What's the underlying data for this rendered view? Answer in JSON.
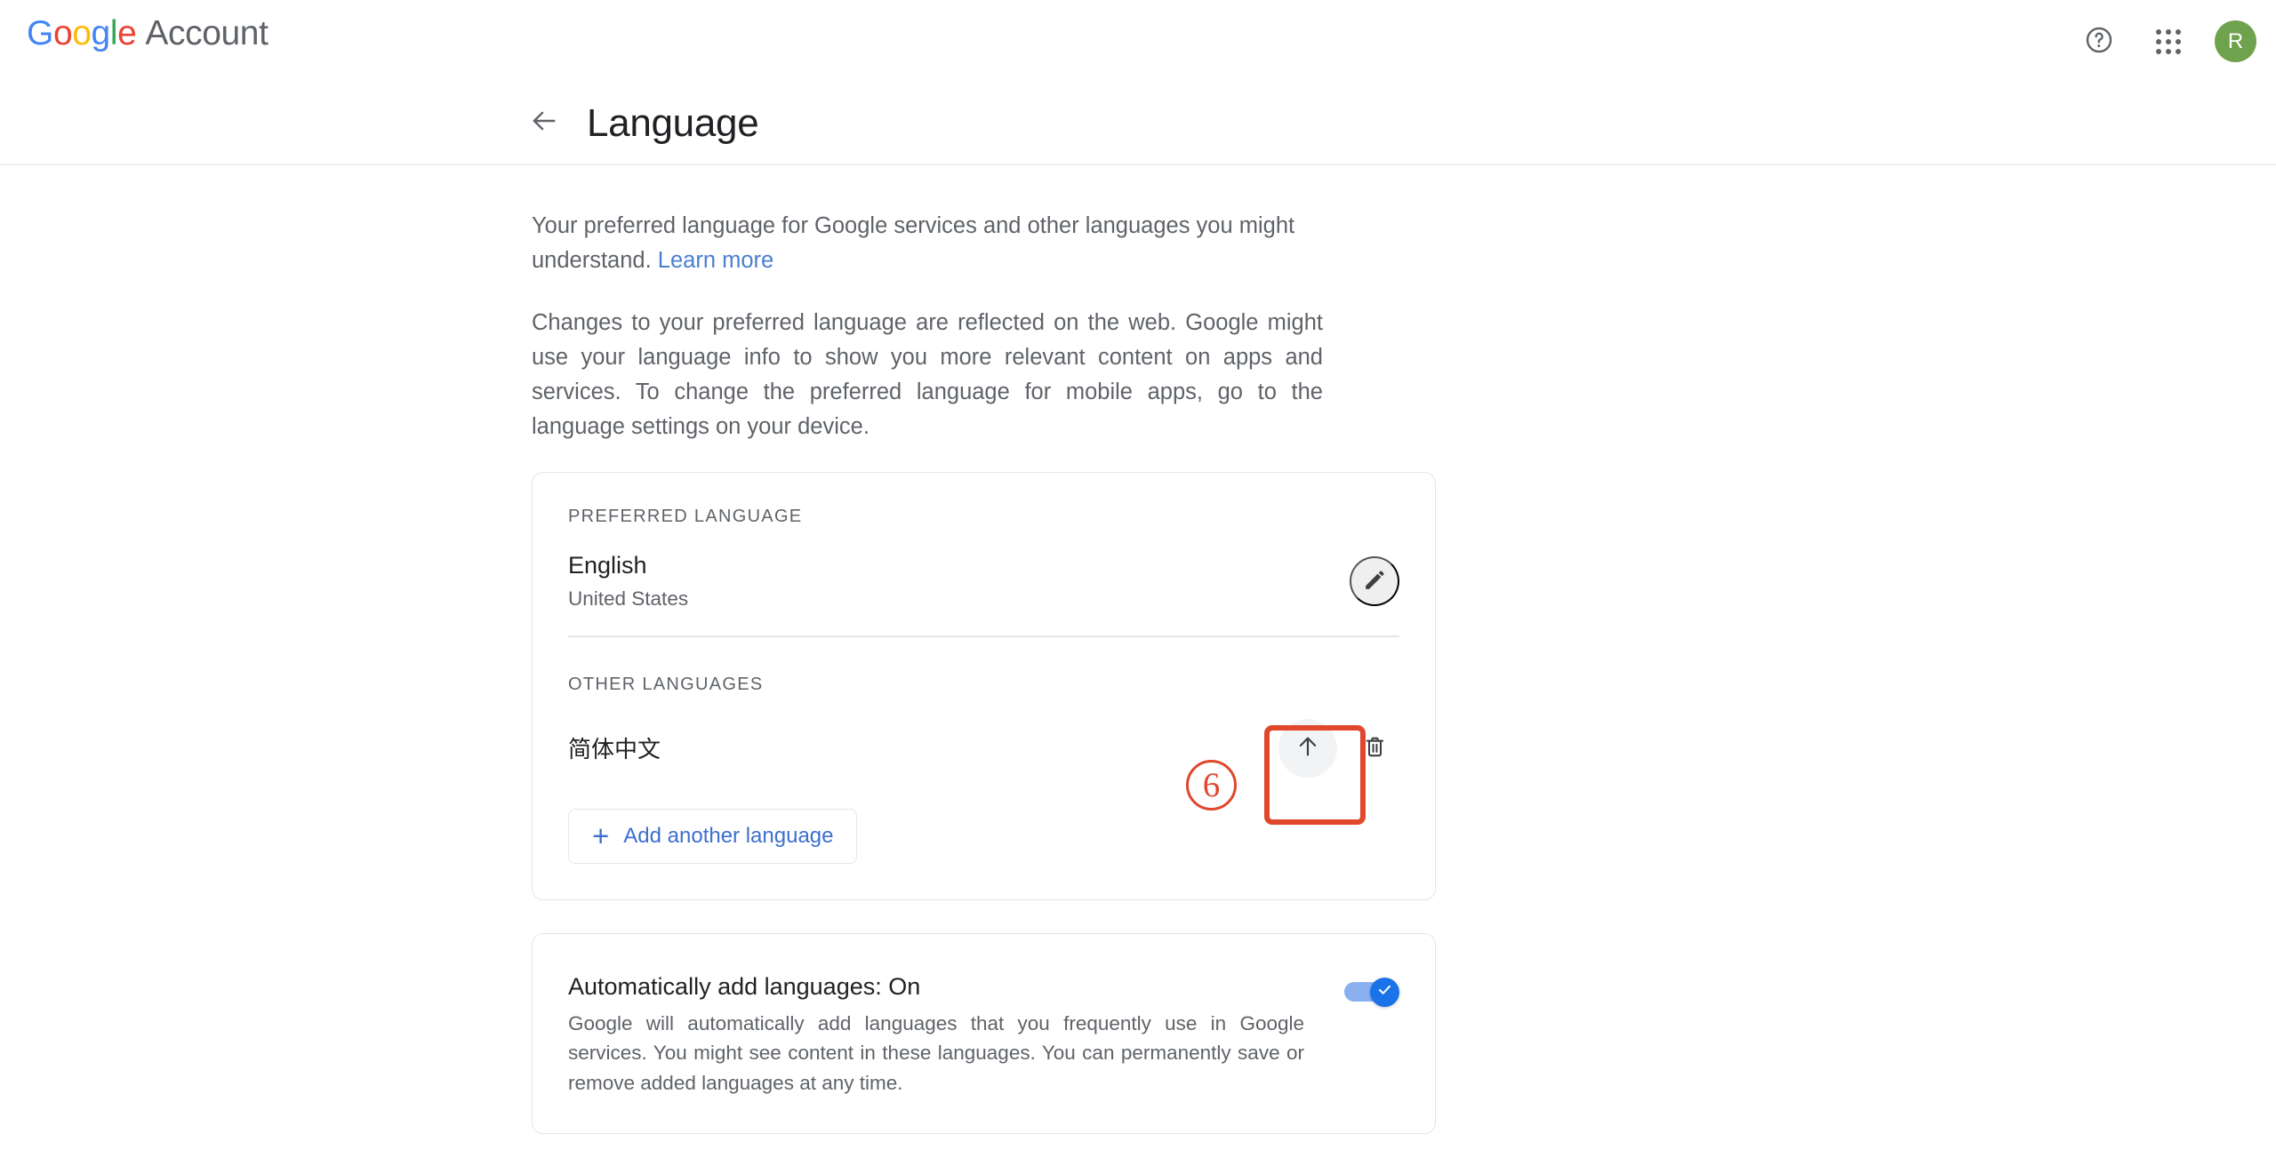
{
  "header": {
    "brand_google": "Google",
    "brand_google_letters": [
      "G",
      "o",
      "o",
      "g",
      "l",
      "e"
    ],
    "brand_account": "Account",
    "help_icon": "help-circle-icon",
    "apps_icon": "apps-grid-icon",
    "avatar_initial": "R",
    "avatar_color": "#6fa24c"
  },
  "title_bar": {
    "back_icon": "arrow-left-icon",
    "title": "Language"
  },
  "intro": {
    "paragraph_1_before_link": "Your preferred language for Google services and other languages you might understand. ",
    "learn_more": "Learn more",
    "paragraph_2": "Changes to your preferred language are reflected on the web. Google might use your language info to show you more relevant content on apps and services. To change the preferred language for mobile apps, go to the language settings on your device."
  },
  "language_card": {
    "preferred_label": "PREFERRED LANGUAGE",
    "preferred_language": "English",
    "preferred_region": "United States",
    "edit_icon": "pencil-icon",
    "other_label": "OTHER LANGUAGES",
    "other_language": "简体中文",
    "move_up_icon": "arrow-up-icon",
    "delete_icon": "trash-icon",
    "add_button_label": "Add another language",
    "add_button_plus": "+"
  },
  "annotation": {
    "step_number": "6",
    "color": "#e0472c"
  },
  "auto_card": {
    "title": "Automatically add languages: On",
    "description": "Google will automatically add languages that you frequently use in Google services. You might see content in these languages. You can permanently save or remove added languages at any time.",
    "toggle_state": "on",
    "toggle_color": "#1a73e8"
  }
}
